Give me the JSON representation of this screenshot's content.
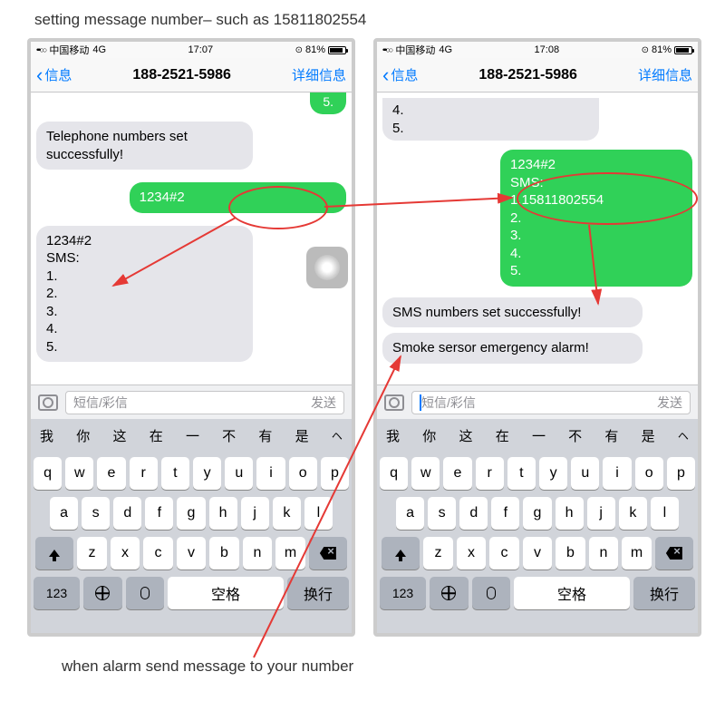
{
  "page": {
    "title": "setting message number– such as 15811802554",
    "caption": "when alarm send message to your number"
  },
  "status": {
    "dots": "•••○○",
    "carrier": "中国移动",
    "network": "4G",
    "battery_pct": "81%"
  },
  "nav": {
    "back": "信息",
    "title": "188-2521-5986",
    "detail": "详细信息"
  },
  "input": {
    "placeholder": "短信/彩信",
    "send": "发送"
  },
  "predictive": {
    "words": [
      "我",
      "你",
      "这",
      "在",
      "一",
      "不",
      "有",
      "是"
    ]
  },
  "keyboard": {
    "row1": [
      "q",
      "w",
      "e",
      "r",
      "t",
      "y",
      "u",
      "i",
      "o",
      "p"
    ],
    "row2": [
      "a",
      "s",
      "d",
      "f",
      "g",
      "h",
      "j",
      "k",
      "l"
    ],
    "row3": [
      "z",
      "x",
      "c",
      "v",
      "b",
      "n",
      "m"
    ],
    "num": "123",
    "space": "空格",
    "return": "换行"
  },
  "phone1": {
    "time": "17:07",
    "stub": "5.",
    "msg1": "Telephone numbers set successfully!",
    "msg2": "1234#2",
    "msg3": "1234#2\nSMS:\n1.\n2.\n3.\n4.\n5."
  },
  "phone2": {
    "time": "17:08",
    "stub1": "4.",
    "stub2": "5.",
    "msg1": "1234#2\nSMS:\n1.15811802554\n2.\n3.\n4.\n5.",
    "msg2": "SMS numbers set successfully!",
    "msg3": "Smoke sersor emergency alarm!"
  }
}
